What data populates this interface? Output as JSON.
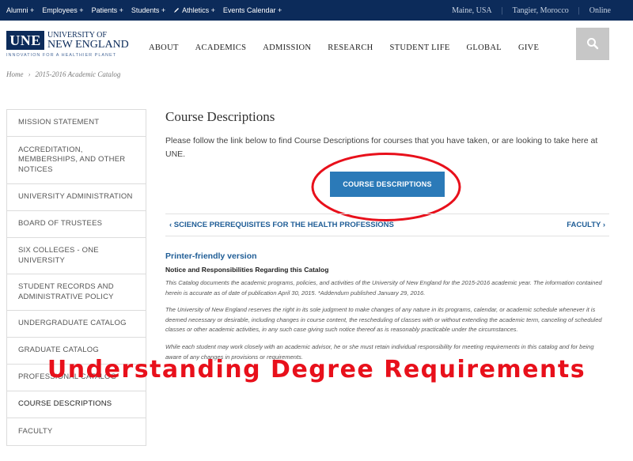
{
  "topbar": {
    "links": [
      "Alumni +",
      "Employees +",
      "Patients +",
      "Students +",
      "Athletics +",
      "Events Calendar +"
    ],
    "campuses": [
      "Maine, USA",
      "Tangier, Morocco",
      "Online"
    ]
  },
  "logo": {
    "abbr": "UNE",
    "line1": "UNIVERSITY OF",
    "line2": "NEW ENGLAND",
    "tagline": "INNOVATION FOR A HEALTHIER PLANET"
  },
  "nav": [
    "ABOUT",
    "ACADEMICS",
    "ADMISSION",
    "RESEARCH",
    "STUDENT LIFE",
    "GLOBAL",
    "GIVE"
  ],
  "breadcrumb": [
    "Home",
    "›",
    "2015-2016 Academic Catalog"
  ],
  "sidebar": [
    "MISSION STATEMENT",
    "ACCREDITATION, MEMBERSHIPS, AND OTHER NOTICES",
    "UNIVERSITY ADMINISTRATION",
    "BOARD OF TRUSTEES",
    "SIX COLLEGES - ONE UNIVERSITY",
    "STUDENT RECORDS AND ADMINISTRATIVE POLICY",
    "UNDERGRADUATE CATALOG",
    "GRADUATE CATALOG",
    "PROFESSIONAL CATALOG",
    "COURSE DESCRIPTIONS",
    "FACULTY"
  ],
  "content": {
    "title": "Course Descriptions",
    "intro": "Please follow the link below to find Course Descriptions for courses that you have taken, or are looking to take here at UNE.",
    "button": "COURSE DESCRIPTIONS",
    "prev": "‹ SCIENCE PREREQUISITES FOR THE HEALTH PROFESSIONS",
    "next": "FACULTY ›",
    "printer": "Printer-friendly version",
    "notice": "Notice and Responsibilities Regarding this Catalog",
    "paragraphs": [
      "This Catalog documents the academic programs, policies, and activities of the University of New England for the 2015-2016 academic year. The information contained herein is accurate as of date of publication April 30, 2015.  *Addendum published January 29, 2016.",
      "The University of New England reserves the right in its sole judgment to make changes of any nature in its programs, calendar, or academic schedule whenever it is deemed necessary or desirable, including changes in course content, the rescheduling of classes with or without extending the academic term, canceling of scheduled classes or other academic activities, in any such case giving such notice thereof as is reasonably practicable under the circumstances.",
      "While each student may work closely with an academic advisor, he or she must retain individual responsibility for meeting requirements in this catalog and for being aware of any changes in provisions or requirements."
    ]
  },
  "overlay": "Understanding Degree Requirements",
  "colors": {
    "navy": "#0c2b5a",
    "button": "#2b7ab8",
    "link": "#1f5d96",
    "accent_red": "#e8101b"
  }
}
